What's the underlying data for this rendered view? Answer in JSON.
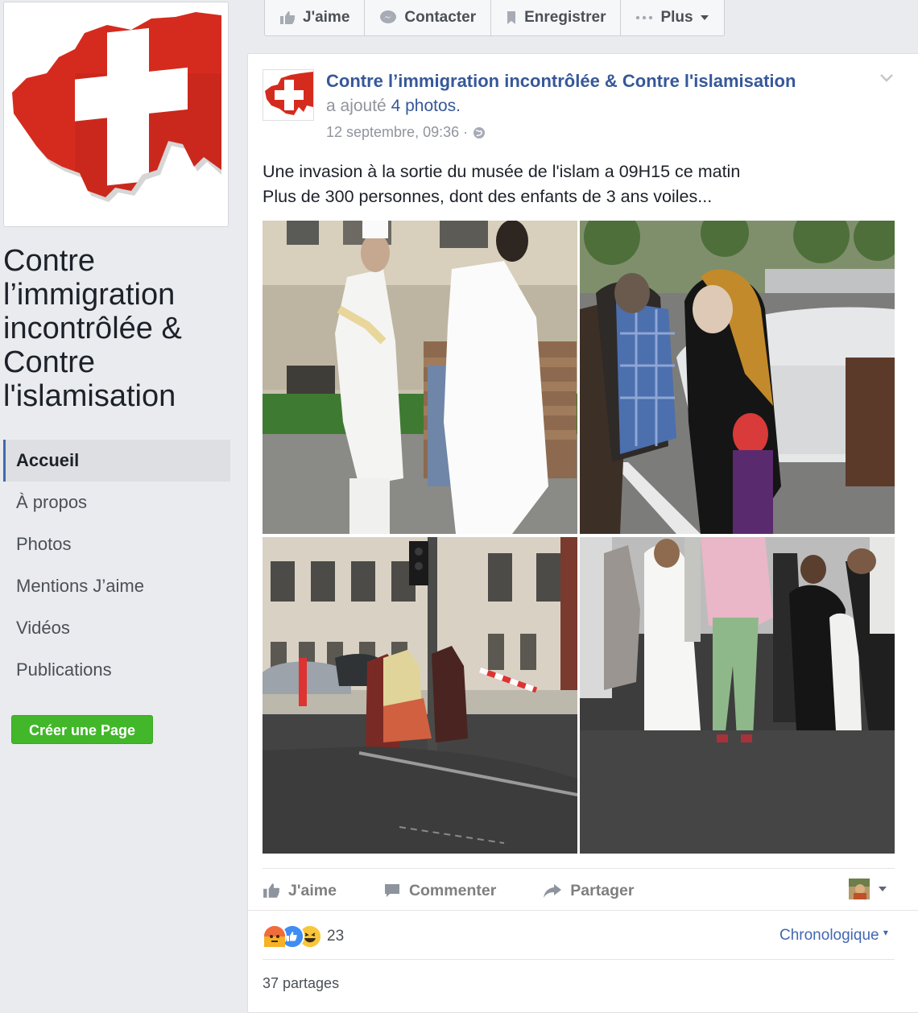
{
  "sidebar": {
    "page_name": "Contre l’immigration incontrôlée & Contre l'islamisation",
    "nav": [
      {
        "label": "Accueil",
        "active": true
      },
      {
        "label": "À propos"
      },
      {
        "label": "Photos"
      },
      {
        "label": "Mentions J’aime"
      },
      {
        "label": "Vidéos"
      },
      {
        "label": "Publications"
      }
    ],
    "create_page": "Créer une Page"
  },
  "action_bar": {
    "like": "J'aime",
    "contact": "Contacter",
    "save": "Enregistrer",
    "more": "Plus"
  },
  "post": {
    "author": "Contre l’immigration incontrôlée & Contre l'islamisation",
    "added_prefix": "a ajouté",
    "added_link": "4 photos",
    "added_suffix": ".",
    "timestamp": "12 septembre, 09:36 ·",
    "text_line1": "Une invasion à la sortie du musée de l'islam a 09H15 ce matin",
    "text_line2": "Plus de 300 personnes, dont des enfants de 3 ans voiles...",
    "photo_count": 4
  },
  "post_actions": {
    "like": "J'aime",
    "comment": "Commenter",
    "share": "Partager"
  },
  "engagement": {
    "reactions": [
      "angry",
      "like",
      "haha"
    ],
    "reaction_count": "23",
    "sort_label": "Chronologique",
    "shares": "37 partages"
  },
  "colors": {
    "link": "#365899",
    "brand_red": "#d52b1e",
    "create_green": "#42b72a",
    "background": "#e9ebee"
  }
}
